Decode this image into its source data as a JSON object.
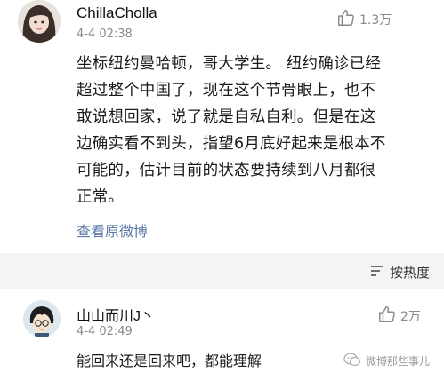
{
  "post": {
    "author": "ChillaCholla",
    "time": "4-4 02:38",
    "likes": "1.3万",
    "content_lines": [
      "坐标纽约曼哈顿，哥大学生。 纽约确诊已经",
      "超过整个中国了，现在这个节骨眼上，也不",
      "敢说想回家，说了就是自私自利。但是在这",
      "边确实看不到头，指望6月底好起来是根本不",
      "可能的，估计目前的状态要持续到八月都很",
      "正常。"
    ],
    "view_original": "查看原微博"
  },
  "sort": {
    "label": "按热度"
  },
  "comment": {
    "author": "山山而川J丶",
    "time": "4-4 02:49",
    "likes": "2万",
    "text": "能回来还是回来吧，都能理解"
  },
  "watermark": {
    "text": "微博那些事儿"
  },
  "icons": {
    "like": "thumbs-up-icon",
    "sort": "sort-icon",
    "watermark": "wechat-logo-icon"
  }
}
